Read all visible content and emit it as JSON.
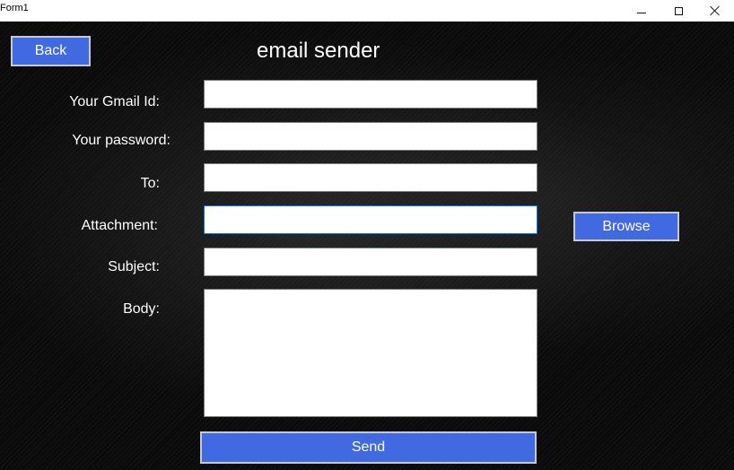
{
  "window": {
    "title": "Form1",
    "controls": {
      "minimize": "minimize-icon",
      "maximize": "maximize-icon",
      "close": "close-icon"
    }
  },
  "app": {
    "title": "email sender"
  },
  "buttons": {
    "back": "Back",
    "browse": "Browse",
    "send": "Send"
  },
  "fields": {
    "gmail": {
      "label": "Your Gmail Id:",
      "value": ""
    },
    "password": {
      "label": "Your password:",
      "value": ""
    },
    "to": {
      "label": "To:",
      "value": ""
    },
    "attachment": {
      "label": "Attachment:",
      "value": ""
    },
    "subject": {
      "label": "Subject:",
      "value": ""
    },
    "body": {
      "label": "Body:",
      "value": ""
    }
  },
  "colors": {
    "button": "#4169e1",
    "button_border": "#c8c8d0",
    "background": "#0a0a0a",
    "focus": "#0078d7"
  }
}
